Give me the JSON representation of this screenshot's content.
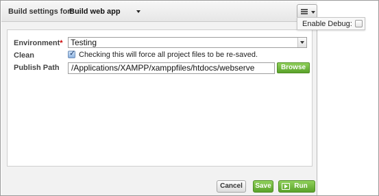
{
  "header": {
    "label": "Build settings for:",
    "target_selected": "Build web app"
  },
  "menu": {
    "icon": "list-menu-icon"
  },
  "form": {
    "environment": {
      "label": "Environment",
      "required_marker": "*",
      "selected": "Testing"
    },
    "clean": {
      "label": "Clean",
      "checked": true,
      "text": "Checking this will force all project files to be re-saved."
    },
    "publish_path": {
      "label": "Publish Path",
      "value": "/Applications/XAMPP/xamppfiles/htdocs/webserve",
      "browse_label": "Browse"
    }
  },
  "footer": {
    "cancel_label": "Cancel",
    "save_label": "Save",
    "run_label": "Run"
  },
  "debug_popover": {
    "label": "Enable Debug:",
    "checked": false
  },
  "colors": {
    "accent_green": "#6cb33f",
    "required_red": "#cc0000"
  }
}
